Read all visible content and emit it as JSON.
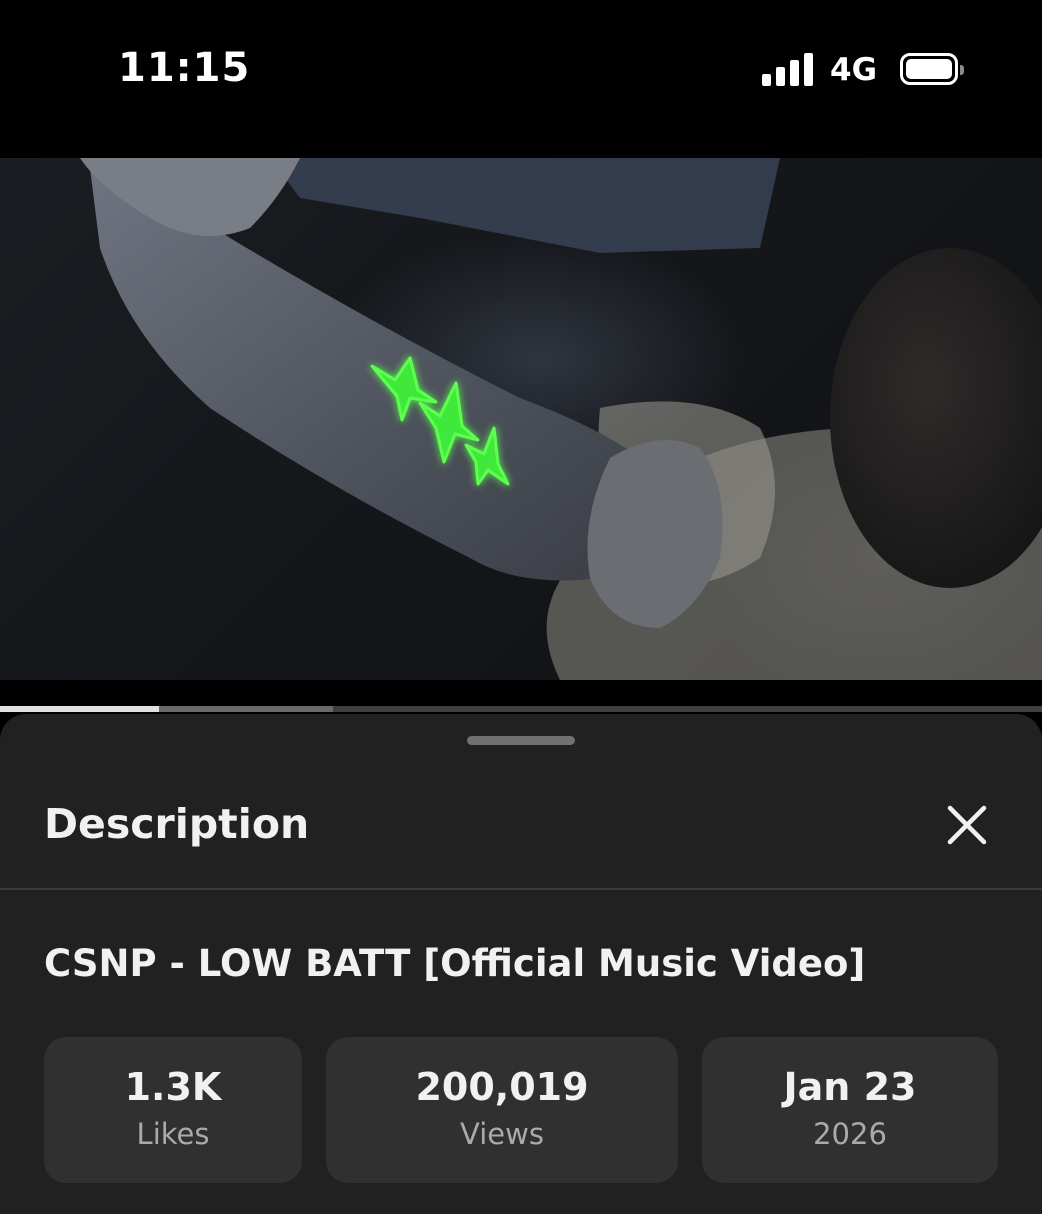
{
  "status_bar": {
    "time": "11:15",
    "network": "4G",
    "icons": [
      "signal-bars-icon",
      "battery-icon"
    ]
  },
  "player": {
    "progress_fraction": 0.153,
    "buffered_fraction": 0.32
  },
  "description_panel": {
    "heading": "Description",
    "close_icon": "close-icon",
    "video_title": "CSNP - LOW BATT [Official Music Video]",
    "stats": [
      {
        "value": "1.3K",
        "label": "Likes"
      },
      {
        "value": "200,019",
        "label": "Views"
      },
      {
        "value": "Jan 23",
        "label": "2026"
      }
    ]
  },
  "colors": {
    "sheet_background": "#212121",
    "stat_card_background": "#303030",
    "waveform_accent": "#5cff4e"
  }
}
